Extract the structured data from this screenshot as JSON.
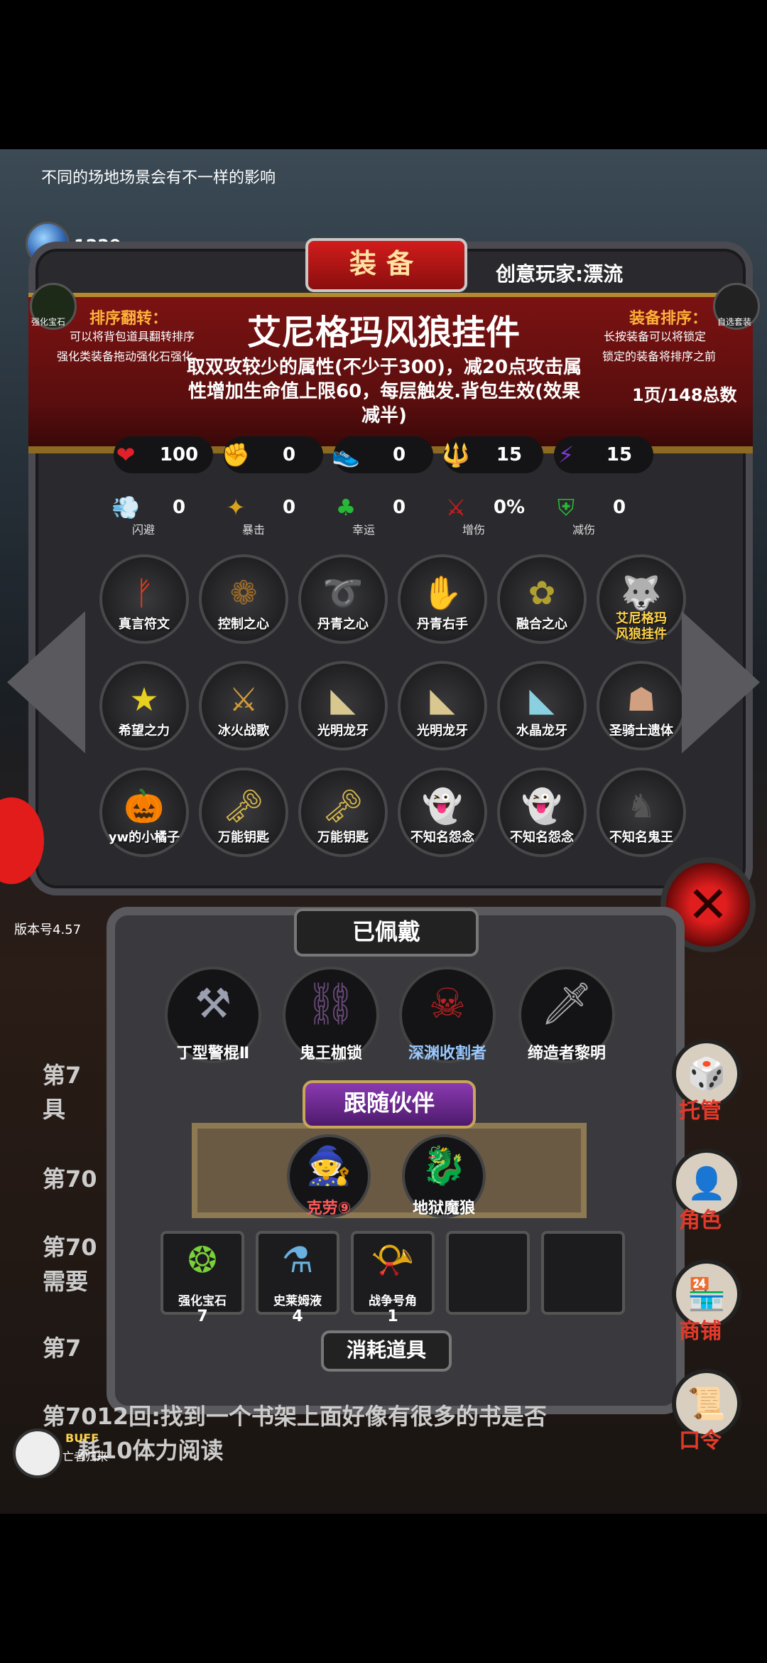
{
  "top_tip": "不同的场地场景会有不一样的影响",
  "currency": {
    "value": "1229",
    "label": "宝石"
  },
  "panel": {
    "title": "装备",
    "player_label": "创意玩家:漂流",
    "sort_left": {
      "icon_label": "强化宝石",
      "title": "排序翻转：",
      "line1": "可以将背包道具翻转排序",
      "line2": "强化类装备拖动强化石强化"
    },
    "sort_right": {
      "icon_label": "自选套装",
      "title": "装备排序：",
      "line1": "长按装备可以将锁定",
      "line2": "锁定的装备将排序之前"
    },
    "item_name": "艾尼格玛风狼挂件",
    "item_desc": "取双攻较少的属性(不少于300)，减20点攻击属性增加生命值上限60，每层触发.背包生效(效果减半)",
    "page_info": "1页/148总数"
  },
  "stats": [
    {
      "icon": "heart-icon",
      "glyph": "❤",
      "value": "100",
      "color": "#e0202a"
    },
    {
      "icon": "strength-icon",
      "glyph": "✊",
      "value": "0",
      "color": "#e6b800"
    },
    {
      "icon": "boot-icon",
      "glyph": "👟",
      "value": "0",
      "color": "#2a8cd6"
    },
    {
      "icon": "magic-staff-icon",
      "glyph": "🔱",
      "value": "15",
      "color": "#c68a1c"
    },
    {
      "icon": "lightning-icon",
      "glyph": "⚡",
      "value": "15",
      "color": "#7a3ad0"
    }
  ],
  "substats": [
    {
      "icon": "dodge-icon",
      "glyph": "💨",
      "value": "0",
      "label": "闪避",
      "color": "#2a8cd6"
    },
    {
      "icon": "crit-icon",
      "glyph": "✦",
      "value": "0",
      "label": "暴击",
      "color": "#d9a21c"
    },
    {
      "icon": "luck-icon",
      "glyph": "♣",
      "value": "0",
      "label": "幸运",
      "color": "#28b838"
    },
    {
      "icon": "damage-up-icon",
      "glyph": "⚔",
      "value": "0%",
      "label": "增伤",
      "color": "#d21c1c"
    },
    {
      "icon": "damage-reduce-icon",
      "glyph": "⛨",
      "value": "0",
      "label": "减伤",
      "color": "#28b838"
    }
  ],
  "equipment_grid": [
    {
      "name": "真言符文",
      "glyph": "ᚠ",
      "color": "#e23a1a"
    },
    {
      "name": "控制之心",
      "glyph": "❁",
      "color": "#9a6a2a"
    },
    {
      "name": "丹青之心",
      "glyph": "➰",
      "color": "#7a4a3a"
    },
    {
      "name": "丹青右手",
      "glyph": "✋",
      "color": "#cfcfcf"
    },
    {
      "name": "融合之心",
      "glyph": "✿",
      "color": "#b0a030"
    },
    {
      "name": "艾尼格玛\n风狼挂件",
      "glyph": "🐺",
      "color": "#bbbbbb",
      "gold": true
    },
    {
      "name": "希望之力",
      "glyph": "★",
      "color": "#e8d020"
    },
    {
      "name": "冰火战歌",
      "glyph": "⚔",
      "color": "#d09a3a"
    },
    {
      "name": "光明龙牙",
      "glyph": "◣",
      "color": "#d8c890"
    },
    {
      "name": "光明龙牙",
      "glyph": "◣",
      "color": "#d8c890"
    },
    {
      "name": "水晶龙牙",
      "glyph": "◣",
      "color": "#8ad0e0"
    },
    {
      "name": "圣骑士遗体",
      "glyph": "☗",
      "color": "#d0a080"
    },
    {
      "name": "yw的小橘子",
      "glyph": "🎃",
      "color": "#e87a1a"
    },
    {
      "name": "万能钥匙",
      "glyph": "🗝",
      "color": "#d8b84a"
    },
    {
      "name": "万能钥匙",
      "glyph": "🗝",
      "color": "#d8b84a"
    },
    {
      "name": "不知名怨念",
      "glyph": "👻",
      "color": "#ffffff"
    },
    {
      "name": "不知名怨念",
      "glyph": "👻",
      "color": "#ffffff"
    },
    {
      "name": "不知名鬼王",
      "glyph": "♞",
      "color": "#555555"
    }
  ],
  "close_glyph": "✕",
  "version": "版本号4.57",
  "worn": {
    "title": "已佩戴",
    "items": [
      {
        "name": "丁型警棍Ⅱ",
        "glyph": "⚒",
        "color": "#9aa0b0"
      },
      {
        "name": "鬼王枷锁",
        "glyph": "⛓",
        "color": "#6a4a7a"
      },
      {
        "name": "深渊收割者",
        "glyph": "☠",
        "color": "#c02020",
        "highlight": true
      },
      {
        "name": "缔造者黎明",
        "glyph": "🗡",
        "color": "#aaaaaa"
      }
    ],
    "follow_title": "跟随伙伴",
    "companions": [
      {
        "name": "克劳⑨",
        "glyph": "🧙",
        "color": "#5a8ad0",
        "highlight": true
      },
      {
        "name": "地狱魔狼",
        "glyph": "🐉",
        "color": "#3a9a3a"
      }
    ],
    "bag": [
      {
        "name": "强化宝石",
        "count": "7",
        "glyph": "❂",
        "color": "#7ad03a"
      },
      {
        "name": "史莱姆液",
        "count": "4",
        "glyph": "⚗",
        "color": "#6ab0e0"
      },
      {
        "name": "战争号角",
        "count": "1",
        "glyph": "📯",
        "color": "#d0c0e0"
      },
      {
        "name": "",
        "count": "",
        "glyph": "",
        "color": "#333333"
      },
      {
        "name": "",
        "count": "",
        "glyph": "",
        "color": "#333333"
      }
    ],
    "consume_title": "消耗道具"
  },
  "story": {
    "line1a": "第7",
    "line1b": "具",
    "line2": "第70",
    "line3a": "第70",
    "line3b": "需要",
    "line4": "第7",
    "line5": "第7012回:找到一个书架上面好像有很多的书是否",
    "line6": "耗10体力阅读"
  },
  "side_menu": [
    {
      "label": "托管",
      "glyph": "🎲"
    },
    {
      "label": "角色",
      "glyph": "👤"
    },
    {
      "label": "商铺",
      "glyph": "🏪"
    },
    {
      "label": "口令",
      "glyph": "📜"
    }
  ],
  "buff": {
    "title": "BUFF",
    "subtitle": "亡者归来"
  }
}
